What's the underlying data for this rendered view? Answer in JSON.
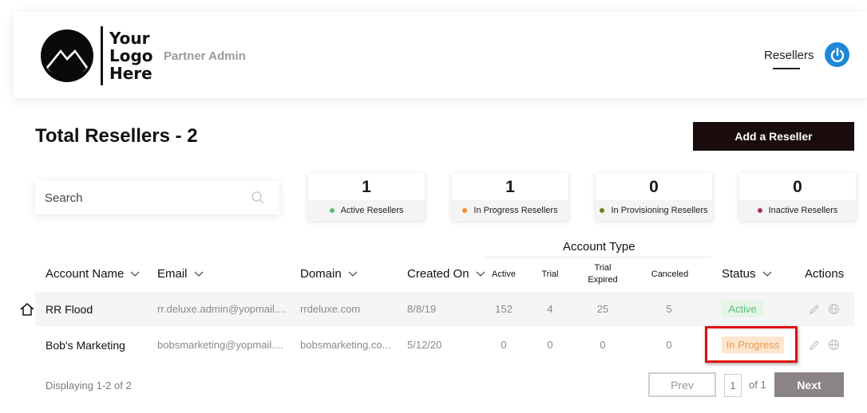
{
  "header": {
    "logo_lines": [
      "Your",
      "Logo",
      "Here"
    ],
    "app_name": "Partner Admin",
    "nav_item": "Resellers"
  },
  "page": {
    "title": "Total Resellers - 2",
    "add_button": "Add a Reseller"
  },
  "search": {
    "placeholder": "Search"
  },
  "stats": [
    {
      "value": "1",
      "label": "Active Resellers",
      "color": "#5bbf72"
    },
    {
      "value": "1",
      "label": "In Progress Resellers",
      "color": "#f08a2c"
    },
    {
      "value": "0",
      "label": "In Provisioning Resellers",
      "color": "#7a7a1e"
    },
    {
      "value": "0",
      "label": "Inactive Resellers",
      "color": "#b0304a"
    }
  ],
  "table": {
    "group_header": "Account Type",
    "columns": {
      "account_name": "Account Name",
      "email": "Email",
      "domain": "Domain",
      "created_on": "Created On",
      "active": "Active",
      "trial": "Trial",
      "trial_expired_1": "Trial",
      "trial_expired_2": "Expired",
      "canceled": "Canceled",
      "status": "Status",
      "actions": "Actions"
    },
    "rows": [
      {
        "account_name": "RR Flood",
        "email": "rr.deluxe.admin@yopmail....",
        "domain": "rrdeluxe.com",
        "created_on": "8/8/19",
        "active": "152",
        "trial": "4",
        "trial_expired": "25",
        "canceled": "5",
        "status": "Active"
      },
      {
        "account_name": "Bob's Marketing",
        "email": "bobsmarketing@yopmail....",
        "domain": "bobsmarketing.co...",
        "created_on": "5/12/20",
        "active": "0",
        "trial": "0",
        "trial_expired": "0",
        "canceled": "0",
        "status": "In Progress"
      }
    ]
  },
  "footer": {
    "displaying": "Displaying 1-2 of 2",
    "prev": "Prev",
    "page_value": "1",
    "of_label": "of 1",
    "next": "Next"
  },
  "colors": {
    "accent": "#1e88d8",
    "primary_button": "#1a0c0c",
    "highlight": "#e01010"
  }
}
